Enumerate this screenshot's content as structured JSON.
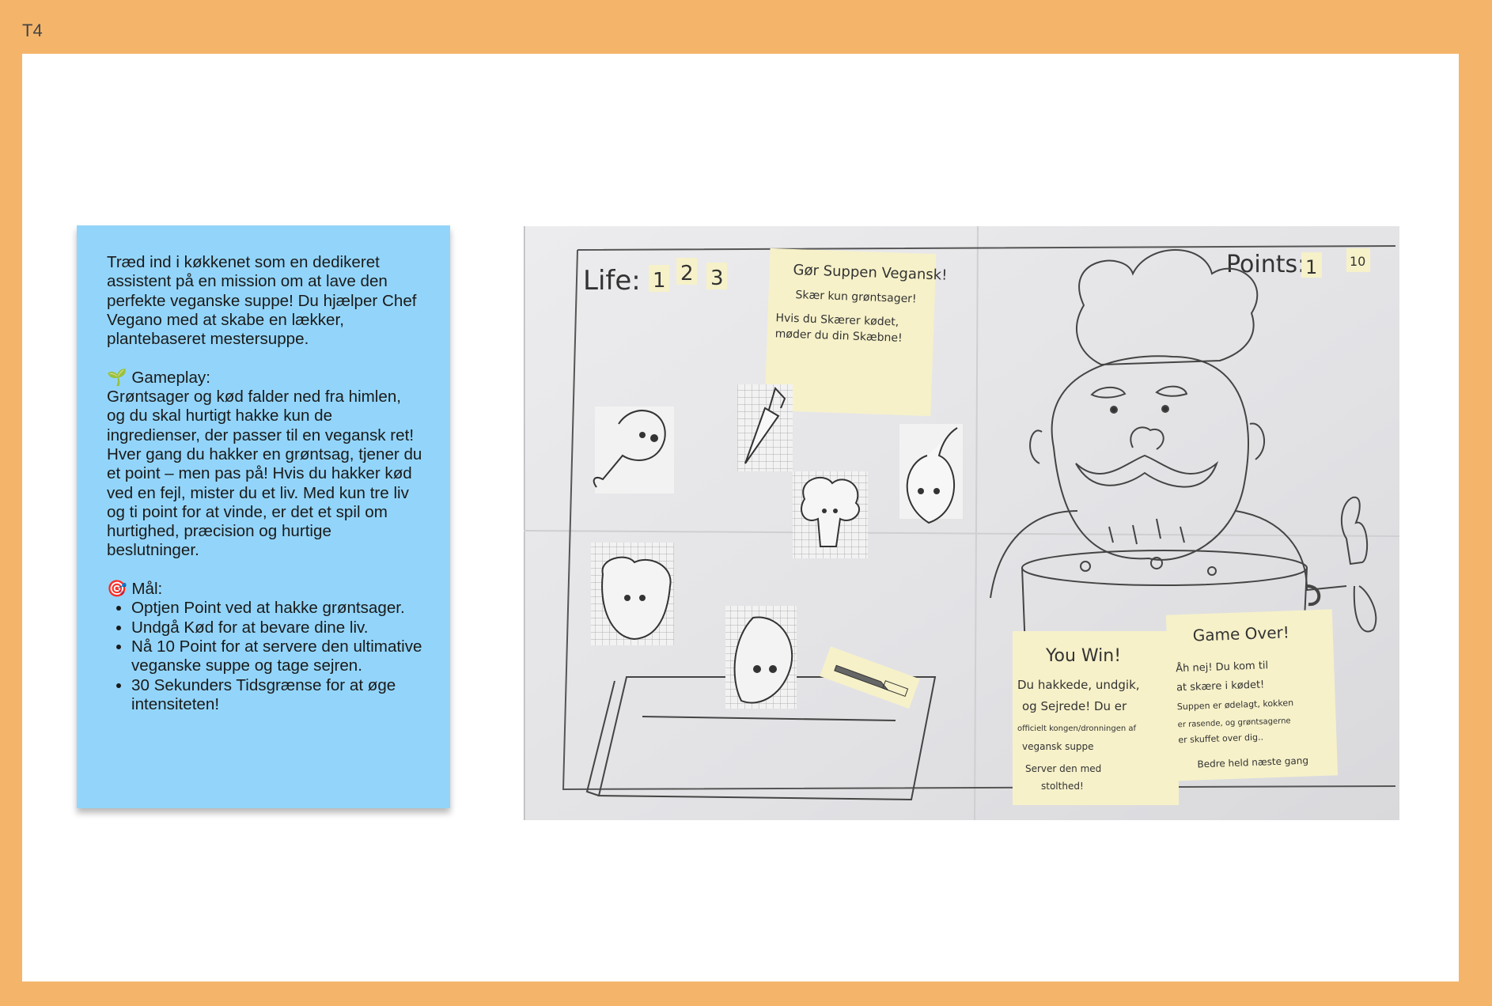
{
  "frame": {
    "label": "T4"
  },
  "description_card": {
    "intro": "Træd ind i køkkenet som en dedikeret assistent på en mission om at lave den perfekte veganske suppe!  Du hjælper Chef Vegano med at skabe en lækker, plantebaseret mestersuppe.",
    "gameplay_icon": "seedling-icon",
    "gameplay_heading": "🌱 Gameplay:",
    "gameplay_text": "Grøntsager og kød falder ned fra himlen, og du skal hurtigt hakke kun de ingredienser, der passer til en vegansk ret! Hver gang du hakker en grøntsag, tjener du et point – men pas på! Hvis du hakker kød ved en fejl, mister du et liv. Med kun tre liv og ti point for at vinde, er det et spil om hurtighed, præcision og hurtige beslutninger.",
    "goals_icon": "target-icon",
    "goals_heading": "🎯 Mål:",
    "goals": [
      "Optjen Point ved at hakke grøntsager.",
      "Undgå Kød for at bevare dine liv.",
      "Nå 10 Point for at servere den ultimative veganske suppe og tage sejren.",
      "30 Sekunders Tidsgrænse for at øge intensiteten!"
    ]
  },
  "sketch": {
    "life_label": "Life:",
    "life_values": [
      "1",
      "2",
      "3"
    ],
    "points_label": "Points:",
    "points_values": [
      "1",
      "10"
    ],
    "instruction_note": {
      "line1": "Gør Suppen Vegansk!",
      "line2": "Skær kun grøntsager!",
      "line3": "Hvis du Skærer kødet,",
      "line4": "møder du din Skæbne!"
    },
    "win_note": {
      "title": "You Win!",
      "line1": "Du hakkede, undgik,",
      "line2": "og Sejrede! Du er",
      "line3": "officielt kongen/dronningen af",
      "line4": "vegansk suppe",
      "line5": "Server den med",
      "line6": "stolthed!"
    },
    "lose_note": {
      "title": "Game Over!",
      "line1": "Åh nej! Du kom til",
      "line2": "at skære i kødet!",
      "line3": "Suppen er ødelagt, kokken",
      "line4": "er rasende, og grøntsagerne",
      "line5": "er skuffet over dig..",
      "line6": "Bedre held næste gang"
    },
    "colors": {
      "sticky": "#f6f1c9",
      "paper": "#e8e8ea",
      "pencil": "#3a3a3a"
    }
  }
}
